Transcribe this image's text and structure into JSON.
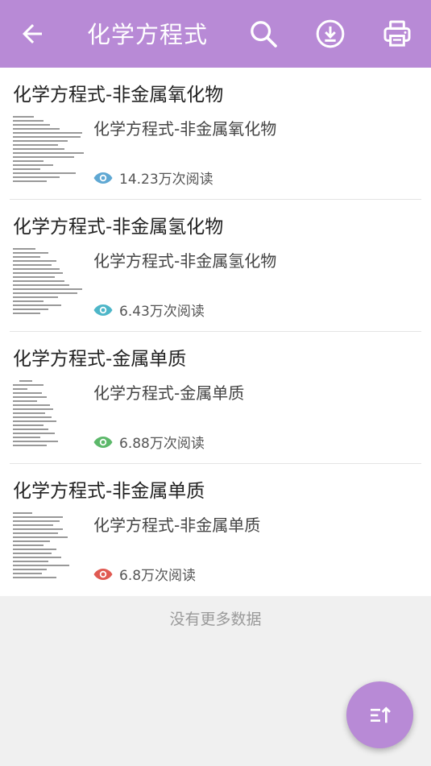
{
  "appbar": {
    "title": "化学方程式",
    "back_icon": "arrow-left-icon",
    "actions": [
      "search-icon",
      "download-icon",
      "printer-icon"
    ],
    "color": "#b88ad6"
  },
  "items": [
    {
      "title": "化学方程式-非金属氧化物",
      "subtitle": "化学方程式-非金属氧化物",
      "reads": "14.23万次阅读",
      "eye_color": "#5fa8d3"
    },
    {
      "title": "化学方程式-非金属氢化物",
      "subtitle": "化学方程式-非金属氢化物",
      "reads": "6.43万次阅读",
      "eye_color": "#4db6c8"
    },
    {
      "title": "化学方程式-金属单质",
      "subtitle": "化学方程式-金属单质",
      "reads": "6.88万次阅读",
      "eye_color": "#5cb86a"
    },
    {
      "title": "化学方程式-非金属单质",
      "subtitle": "化学方程式-非金属单质",
      "reads": "6.8万次阅读",
      "eye_color": "#e05a52"
    }
  ],
  "footer": {
    "no_more": "没有更多数据"
  },
  "fab": {
    "icon": "sort-ascending-icon"
  }
}
